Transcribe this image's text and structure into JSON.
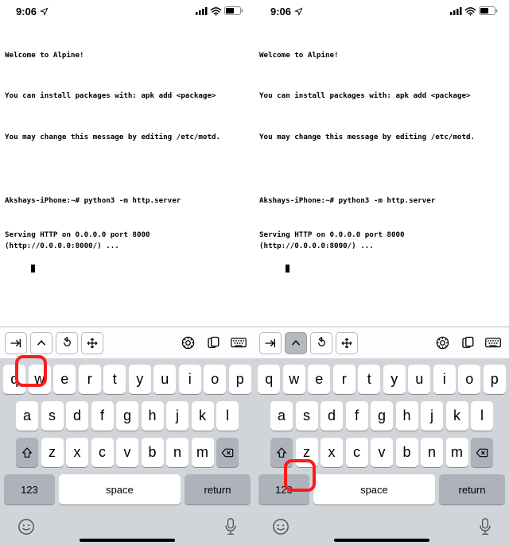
{
  "status": {
    "time": "9:06",
    "loc_icon": "location-arrow",
    "signal_icon": "signal-bars",
    "wifi_icon": "wifi",
    "battery_icon": "battery"
  },
  "terminal": {
    "welcome": "Welcome to Alpine!",
    "install": "You can install packages with: apk add <package>",
    "motd": "You may change this message by editing /etc/motd.",
    "cmd1": "Akshays-iPhone:~# python3 -m http.server",
    "cmd2": "Serving HTTP on 0.0.0.0 port 8000 (http://0.0.0.0:8000/) ..."
  },
  "toolbar": {
    "tab_icon": "tab-arrow",
    "ctrl_icon": "chevron-up",
    "undo_icon": "undo",
    "move_icon": "arrows-out",
    "gear_icon": "gear",
    "paste_icon": "clipboard",
    "kb_icon": "keyboard"
  },
  "keys": {
    "row1": [
      "q",
      "w",
      "e",
      "r",
      "t",
      "y",
      "u",
      "i",
      "o",
      "p"
    ],
    "row2": [
      "a",
      "s",
      "d",
      "f",
      "g",
      "h",
      "j",
      "k",
      "l"
    ],
    "row3": [
      "z",
      "x",
      "c",
      "v",
      "b",
      "n",
      "m"
    ],
    "shift": "shift",
    "backspace": "backspace",
    "num": "123",
    "space": "space",
    "return": "return",
    "emoji": "emoji",
    "mic": "mic"
  },
  "left_screen": {
    "ctrl_active": false
  },
  "right_screen": {
    "ctrl_active": true
  }
}
